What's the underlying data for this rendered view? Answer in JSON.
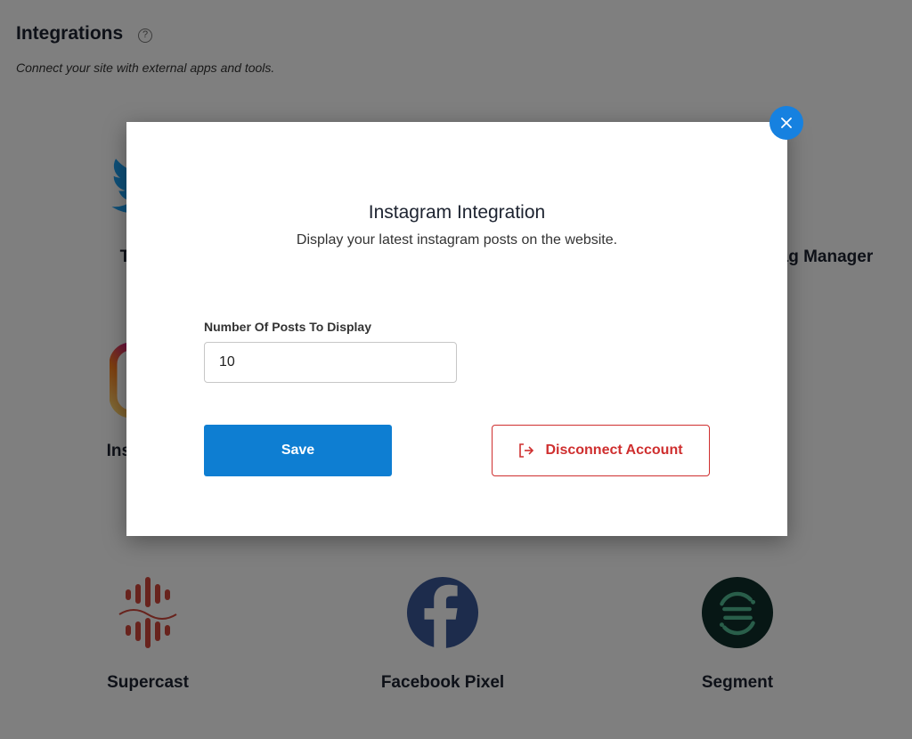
{
  "header": {
    "title": "Integrations",
    "help_icon": "question-circle-icon",
    "subtitle": "Connect your site with external apps and tools."
  },
  "background_cards": [
    {
      "label": "Twitter",
      "icon": "twitter-icon",
      "color": "#1da1f2"
    },
    {
      "label": "Google Tag Manager",
      "icon": "google-tag-manager-icon"
    },
    {
      "label": "Instagram",
      "icon": "instagram-icon"
    },
    {
      "label": "Supercast",
      "icon": "supercast-icon",
      "color": "#d0473b"
    },
    {
      "label": "Facebook Pixel",
      "icon": "facebook-icon",
      "color": "#3b5998"
    },
    {
      "label": "Segment",
      "icon": "segment-icon",
      "color": "#52bd94"
    }
  ],
  "modal": {
    "title": "Instagram Integration",
    "description": "Display your latest instagram posts on the website.",
    "field_label": "Number Of Posts To Display",
    "field_value": "10",
    "save_label": "Save",
    "disconnect_label": "Disconnect Account",
    "disconnect_icon": "logout-icon",
    "close_icon": "close-icon",
    "accent_color": "#0e7ed2",
    "danger_color": "#cf2f2f"
  }
}
